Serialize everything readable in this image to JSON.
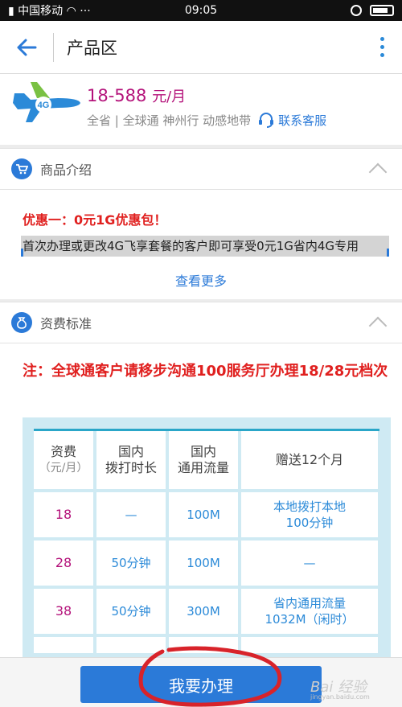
{
  "status_bar": {
    "carrier": "中国移动",
    "time": "09:05",
    "dots": "···"
  },
  "nav": {
    "title": "产品区"
  },
  "product": {
    "price": "18-588",
    "price_unit": "元/月",
    "tags": "全省 | 全球通 神州行 动感地带",
    "service_label": "联系客服",
    "badge": "4G"
  },
  "sections": {
    "intro_title": "商品介绍",
    "fee_title": "资费标准"
  },
  "intro": {
    "promo_title": "优惠一：0元1G优惠包！",
    "promo_desc": "首次办理或更改4G飞享套餐的客户即可享受0元1G省内4G专用",
    "more_link": "查看更多"
  },
  "fee": {
    "note": "注：全球通客户请移步沟通100服务厅办理18/28元档次",
    "headers": {
      "col1": "资费",
      "col1_sub": "（元/月）",
      "col2_a": "国内",
      "col2_b": "拨打时长",
      "col3_a": "国内",
      "col3_b": "通用流量",
      "col4": "赠送12个月"
    },
    "rows": [
      {
        "fee": "18",
        "calls": "—",
        "data": "100M",
        "bonus_a": "本地拨打本地",
        "bonus_b": "100分钟"
      },
      {
        "fee": "28",
        "calls": "50分钟",
        "data": "100M",
        "bonus_a": "—",
        "bonus_b": ""
      },
      {
        "fee": "38",
        "calls": "50分钟",
        "data": "300M",
        "bonus_a": "省内通用流量",
        "bonus_b": "1032M（闲时）"
      }
    ]
  },
  "bottom": {
    "apply_label": "我要办理"
  },
  "watermark": {
    "brand": "Bai 经验",
    "url": "jingyan.baidu.com"
  },
  "colors": {
    "accent": "#2b7ad8",
    "price": "#b4127a",
    "alert": "#e0201f"
  }
}
